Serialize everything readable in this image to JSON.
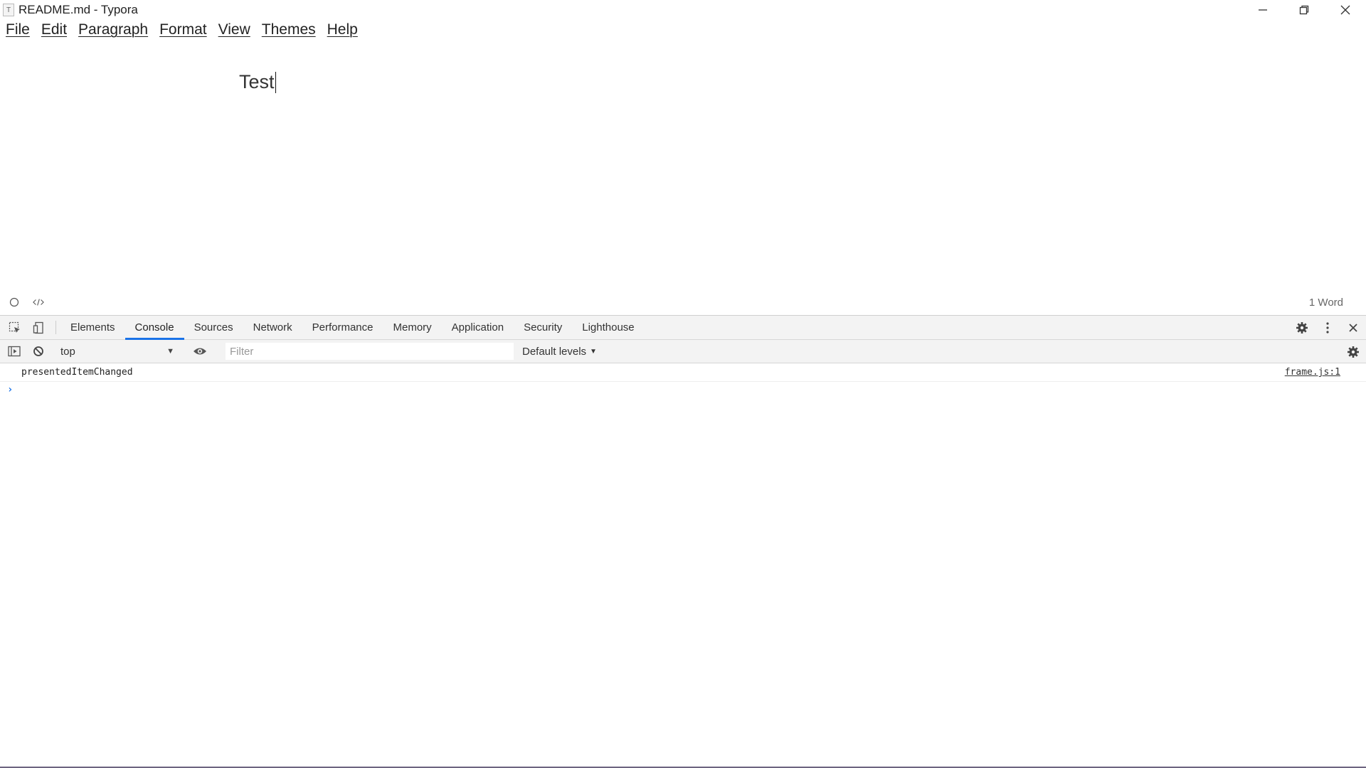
{
  "window": {
    "app_icon_glyph": "T",
    "title": "README.md - Typora"
  },
  "menu": [
    {
      "label": "File"
    },
    {
      "label": "Edit"
    },
    {
      "label": "Paragraph"
    },
    {
      "label": "Format"
    },
    {
      "label": "View"
    },
    {
      "label": "Themes"
    },
    {
      "label": "Help"
    }
  ],
  "editor": {
    "content": "Test"
  },
  "status_bar": {
    "word_count": "1 Word"
  },
  "devtools": {
    "tabs": [
      {
        "label": "Elements"
      },
      {
        "label": "Console",
        "active": true
      },
      {
        "label": "Sources"
      },
      {
        "label": "Network"
      },
      {
        "label": "Performance"
      },
      {
        "label": "Memory"
      },
      {
        "label": "Application"
      },
      {
        "label": "Security"
      },
      {
        "label": "Lighthouse"
      }
    ],
    "toolbar": {
      "context": "top",
      "filter_placeholder": "Filter",
      "levels": "Default levels"
    },
    "console": {
      "messages": [
        {
          "text": "presentedItemChanged",
          "source": "frame.js:1"
        }
      ],
      "prompt": "›"
    }
  },
  "colors": {
    "accent": "#1a73e8",
    "bottom_edge": "#6d6480"
  }
}
